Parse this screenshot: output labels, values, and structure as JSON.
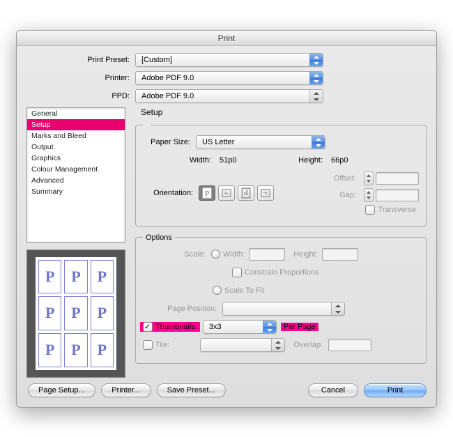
{
  "title": "Print",
  "header": {
    "preset_label": "Print Preset:",
    "preset_value": "[Custom]",
    "printer_label": "Printer:",
    "printer_value": "Adobe PDF 9.0",
    "ppd_label": "PPD:",
    "ppd_value": "Adobe PDF 9.0"
  },
  "sidebar": {
    "items": [
      "General",
      "Setup",
      "Marks and Bleed",
      "Output",
      "Graphics",
      "Colour Management",
      "Advanced",
      "Summary"
    ],
    "selected_index": 1
  },
  "panel_title": "Setup",
  "paper": {
    "legend": "Paper Size:",
    "value": "US Letter",
    "width_label": "Width:",
    "width_value": "51p0",
    "height_label": "Height:",
    "height_value": "66p0",
    "orientation_label": "Orientation:",
    "offset_label": "Offset:",
    "gap_label": "Gap:",
    "transverse_label": "Transverse"
  },
  "options": {
    "legend": "Options",
    "scale_label": "Scale:",
    "width_label": "Width:",
    "height_label": "Height:",
    "constrain_label": "Constrain Proportions",
    "fit_label": "Scale To Fit",
    "page_position_label": "Page Position:",
    "thumbnails_label": "Thumbnails:",
    "thumbnails_value": "3x3",
    "per_page_label": "Per Page",
    "thumbnails_checked": true,
    "tile_label": "Tile:",
    "overlap_label": "Overlap:"
  },
  "preview_glyph": "P",
  "buttons": {
    "page_setup": "Page Setup...",
    "printer": "Printer...",
    "save_preset": "Save Preset...",
    "cancel": "Cancel",
    "print": "Print"
  }
}
